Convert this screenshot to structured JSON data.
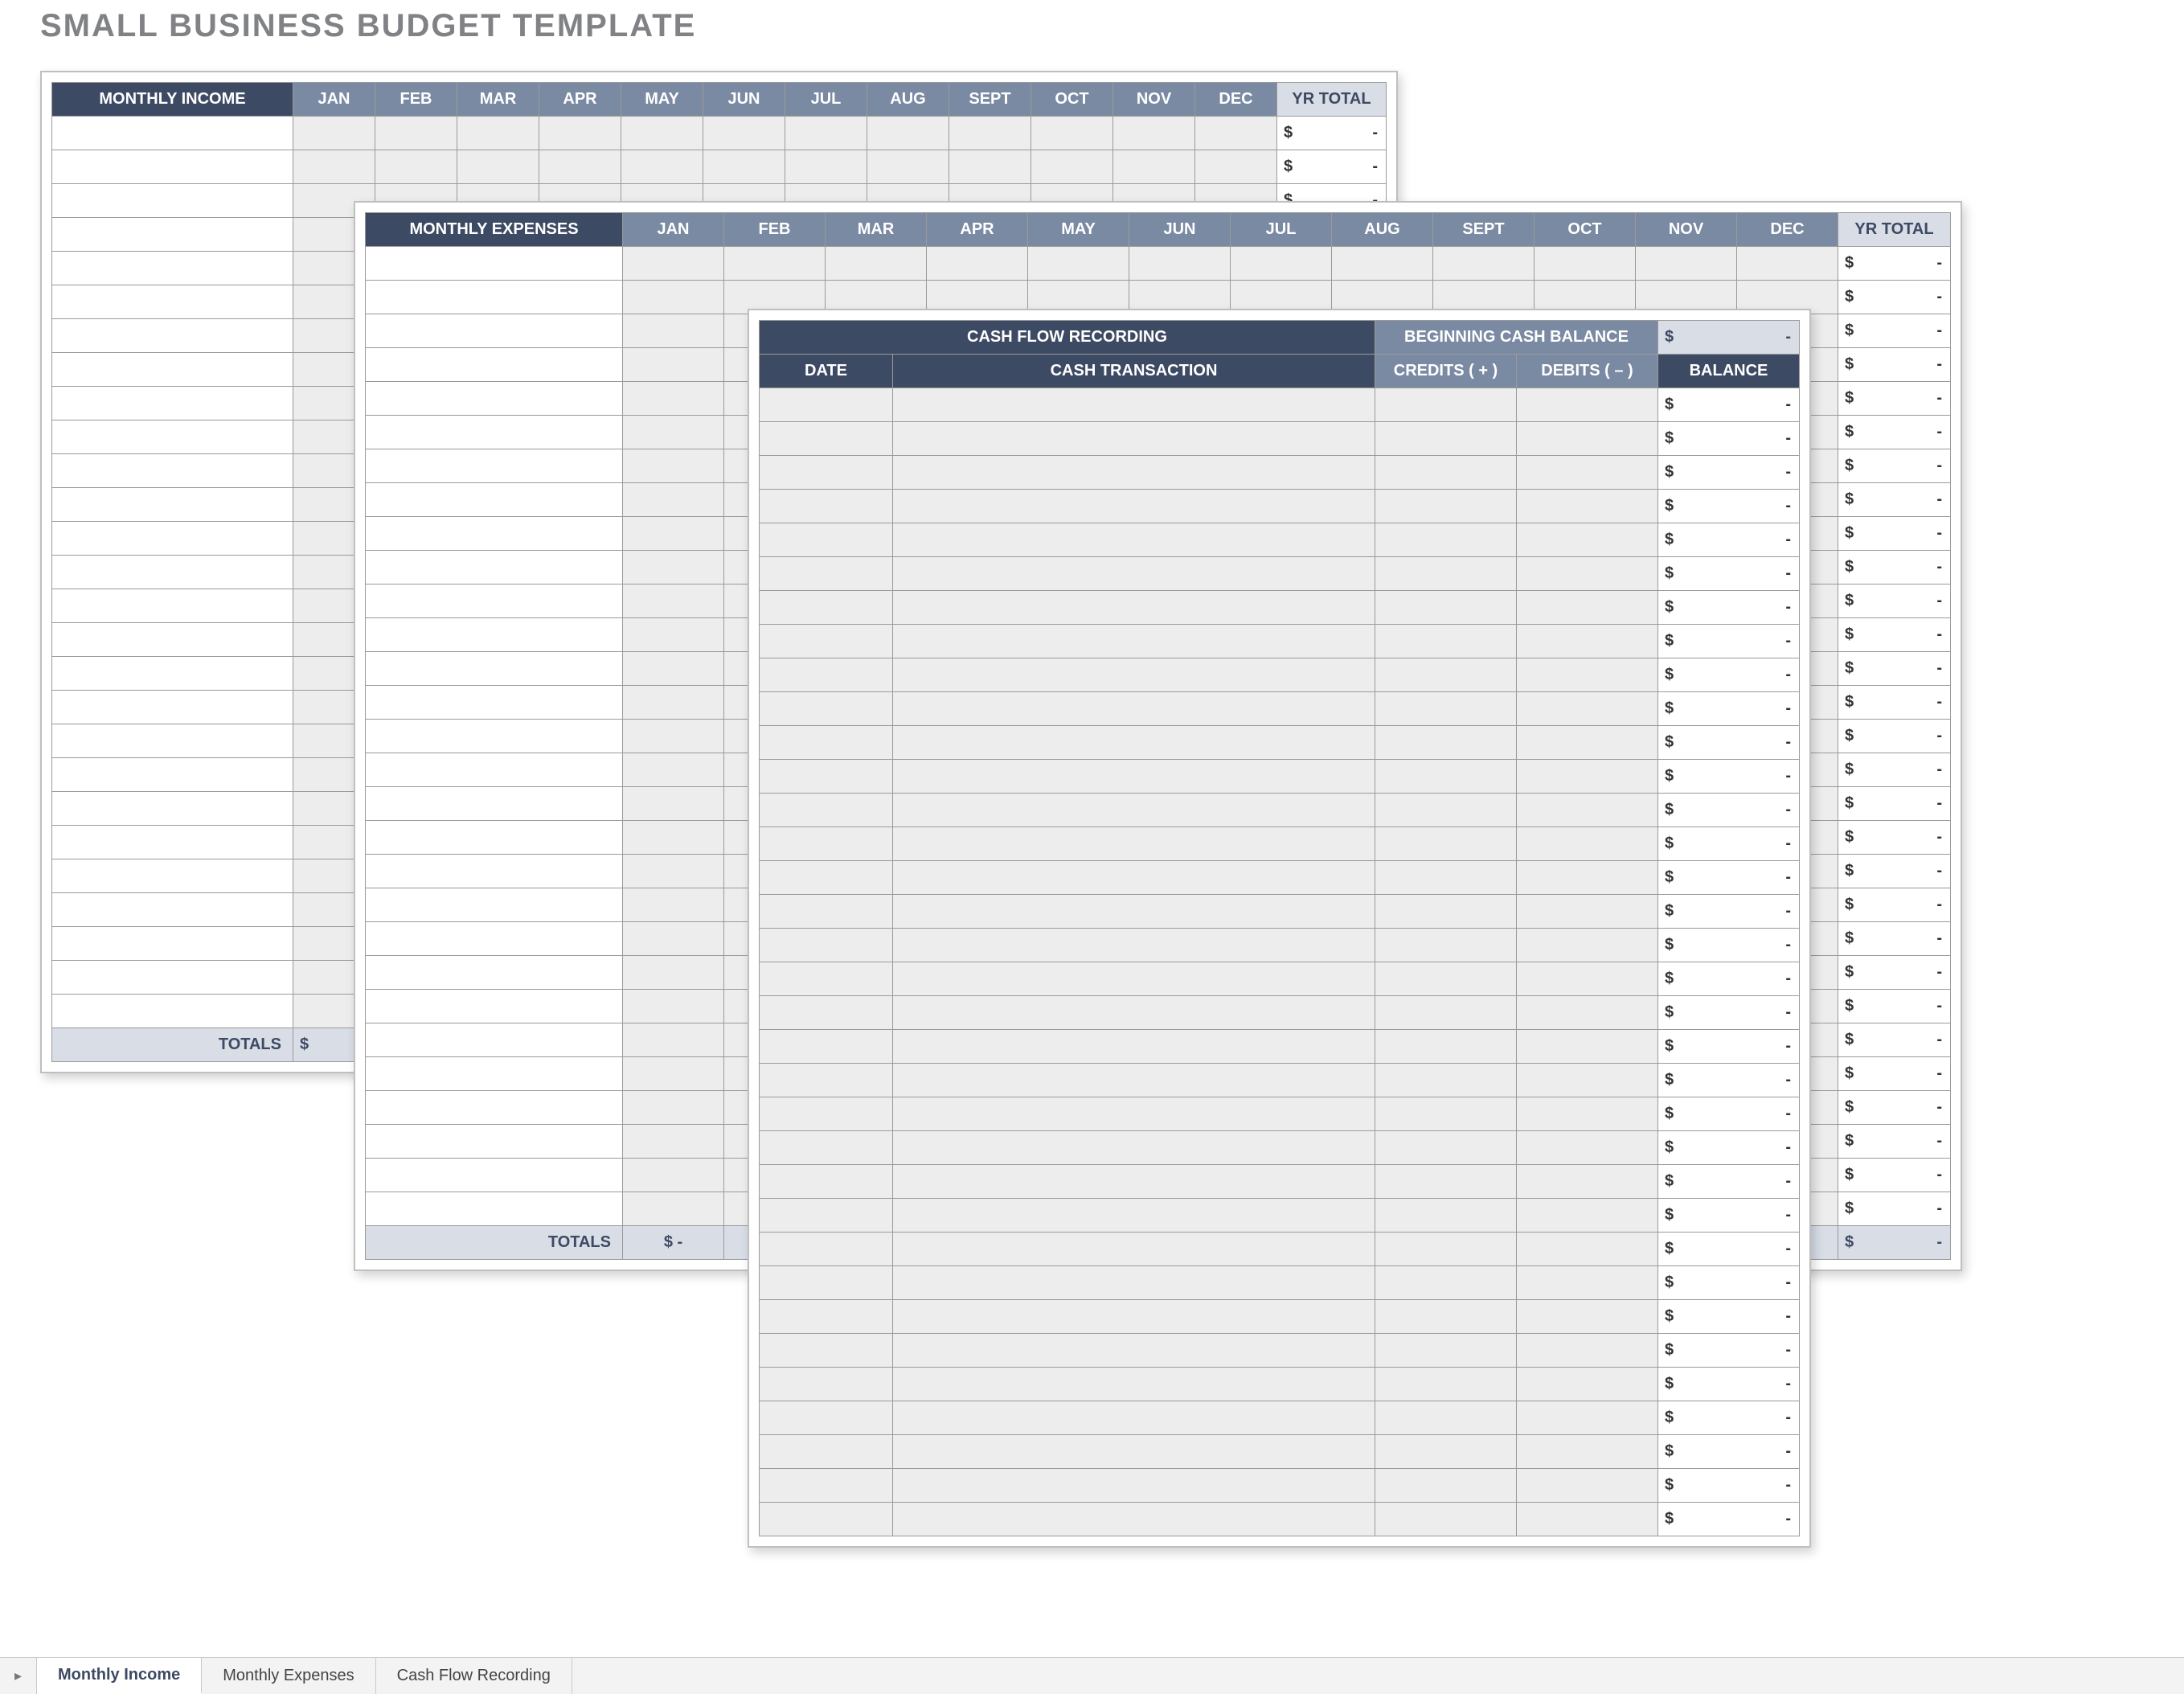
{
  "page_title": "SMALL BUSINESS BUDGET TEMPLATE",
  "months": [
    "JAN",
    "FEB",
    "MAR",
    "APR",
    "MAY",
    "JUN",
    "JUL",
    "AUG",
    "SEPT",
    "OCT",
    "NOV",
    "DEC"
  ],
  "income": {
    "header": "MONTHLY INCOME",
    "yr_total_label": "YR TOTAL",
    "totals_label": "TOTALS",
    "rows": 27,
    "yr_total_cell": {
      "currency": "$",
      "value": "-"
    },
    "totals_first_cell": "$"
  },
  "expenses": {
    "header": "MONTHLY EXPENSES",
    "yr_total_label": "YR TOTAL",
    "totals_label": "TOTALS",
    "rows": 29,
    "yr_total_cell": {
      "currency": "$",
      "value": "-"
    },
    "totals_first_cell": {
      "currency": "$",
      "value": "-"
    },
    "totals_yr_cell": {
      "currency": "$",
      "value": "-"
    }
  },
  "cashflow": {
    "title": "CASH FLOW RECORDING",
    "begin_label": "BEGINNING CASH BALANCE",
    "begin_cell": {
      "currency": "$",
      "value": "-"
    },
    "date_label": "DATE",
    "trans_label": "CASH TRANSACTION",
    "credits_label": "CREDITS ( + )",
    "debits_label": "DEBITS ( – )",
    "balance_label": "BALANCE",
    "rows": 34,
    "balance_cell": {
      "currency": "$",
      "value": "-"
    }
  },
  "tabs": {
    "t1": "Monthly Income",
    "t2": "Monthly Expenses",
    "t3": "Cash Flow Recording"
  }
}
